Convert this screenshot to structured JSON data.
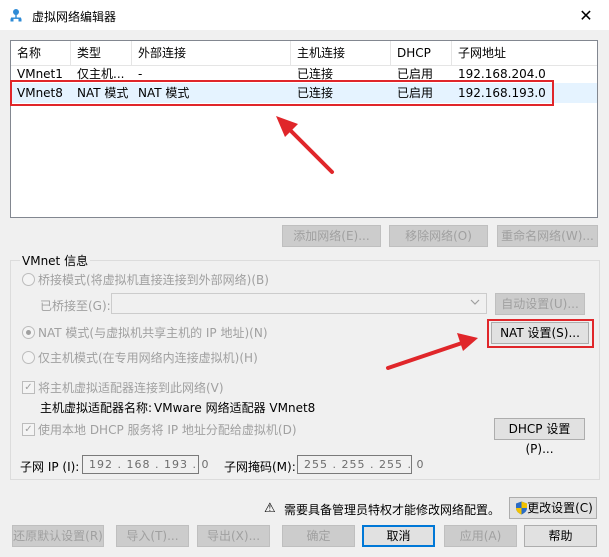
{
  "window": {
    "title": "虚拟网络编辑器",
    "close_glyph": "✕"
  },
  "network_table": {
    "columns": [
      "名称",
      "类型",
      "外部连接",
      "主机连接",
      "DHCP",
      "子网地址"
    ],
    "rows": [
      {
        "name": "VMnet1",
        "type": "仅主机...",
        "external": "-",
        "host": "已连接",
        "dhcp": "已启用",
        "subnet": "192.168.204.0"
      },
      {
        "name": "VMnet8",
        "type": "NAT 模式",
        "external": "NAT 模式",
        "host": "已连接",
        "dhcp": "已启用",
        "subnet": "192.168.193.0"
      }
    ],
    "selected_row": 1
  },
  "table_buttons": {
    "add": "添加网络(E)...",
    "remove": "移除网络(O)",
    "rename": "重命名网络(W)..."
  },
  "vmnet_info": {
    "group_label": "VMnet 信息",
    "bridge_mode": "桥接模式(将虚拟机直接连接到外部网络)(B)",
    "bridged_to": "已桥接至(G):",
    "bridged_to_value": "",
    "auto_settings": "自动设置(U)...",
    "nat_mode": "NAT 模式(与虚拟机共享主机的 IP 地址)(N)",
    "nat_settings": "NAT 设置(S)...",
    "host_only_mode": "仅主机模式(在专用网络内连接虚拟机)(H)",
    "connect_adapter": "将主机虚拟适配器连接到此网络(V)",
    "adapter_name_label": "主机虚拟适配器名称:",
    "adapter_name_value": "VMware 网络适配器 VMnet8",
    "use_dhcp": "使用本地 DHCP 服务将 IP 地址分配给虚拟机(D)",
    "dhcp_settings": "DHCP 设置(P)...",
    "subnet_ip_label": "子网 IP (I):",
    "subnet_ip_value": "192 . 168 . 193 . 0",
    "subnet_mask_label": "子网掩码(M):",
    "subnet_mask_value": "255 . 255 . 255 . 0",
    "check_glyph": "✓"
  },
  "footer": {
    "admin_notice": "需要具备管理员特权才能修改网络配置。",
    "warning_glyph": "⚠",
    "change_settings": "更改设置(C)",
    "restore_defaults": "还原默认设置(R)",
    "import": "导入(T)...",
    "export": "导出(X)...",
    "ok": "确定",
    "cancel": "取消",
    "apply": "应用(A)",
    "help": "帮助"
  },
  "colors": {
    "highlight": "#e0262a",
    "selection": "#e5f3ff",
    "focus": "#0078d7"
  }
}
